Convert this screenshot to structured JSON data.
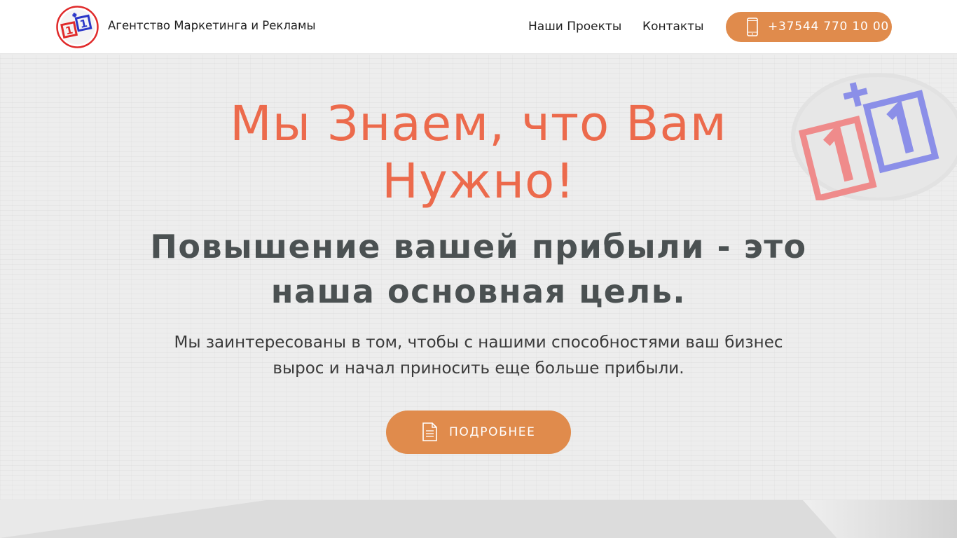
{
  "header": {
    "logo_text": "1+1",
    "brand": "Агентство Маркетинга и Рекламы",
    "nav": [
      {
        "label": "Наши Проекты"
      },
      {
        "label": "Контакты"
      }
    ],
    "phone": {
      "label": "+37544 770 10 00",
      "icon": "phone-icon"
    }
  },
  "hero": {
    "title": "Мы Знаем, что Вам Нужно!",
    "subtitle": "Повышение вашей прибыли - это наша основная цель.",
    "lead": "Мы заинтересованы в том, чтобы с нашими способностями ваш бизнес вырос и начал приносить еще больше прибыли.",
    "cta": {
      "label": "ПОДРОБНЕЕ",
      "icon": "document-icon"
    },
    "badge_text": "1+1"
  },
  "colors": {
    "accent": "#e08b4c",
    "title": "#ec6a4c",
    "subtitle": "#4b5152",
    "logo_red": "#e02a2a",
    "logo_blue": "#2a36c8"
  }
}
